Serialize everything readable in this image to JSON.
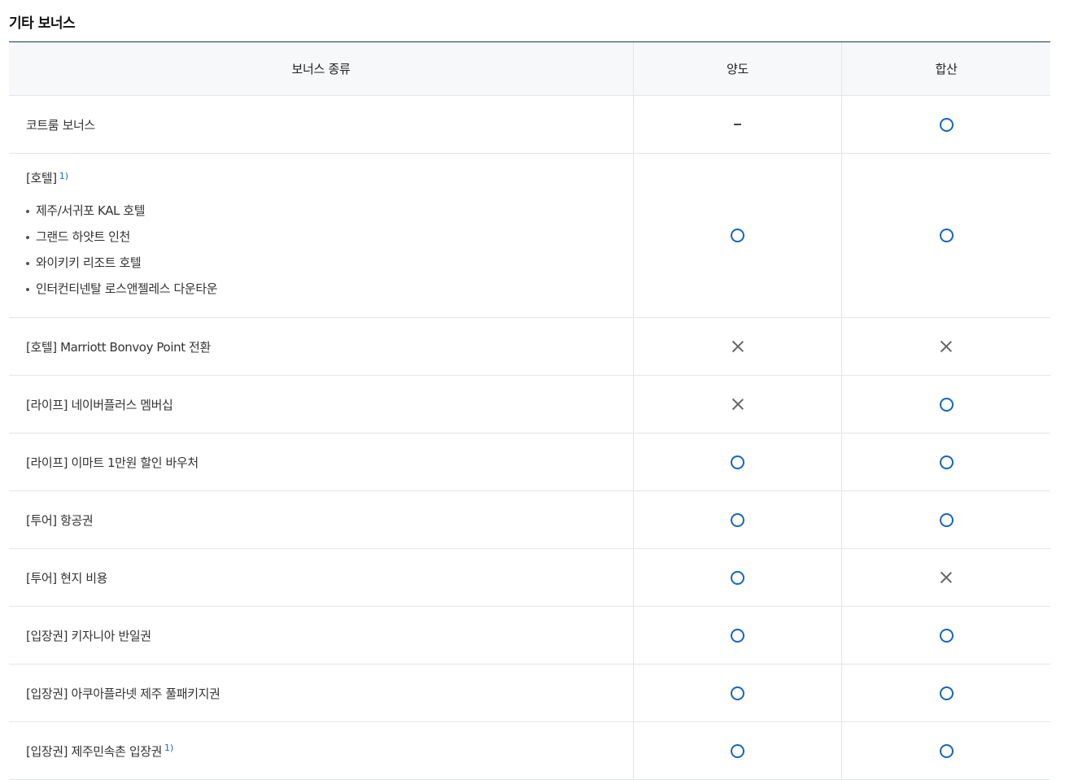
{
  "section_title": "기타 보너스",
  "header": {
    "type": "보너스 종류",
    "transfer": "양도",
    "combine": "합산"
  },
  "rows": [
    {
      "label": "코트룸 보너스",
      "transfer": "dash",
      "combine": "o"
    },
    {
      "label": "[호텔]",
      "sup": "1)",
      "items": [
        "제주/서귀포 KAL 호텔",
        "그랜드 하얏트 인천",
        "와이키키 리조트 호텔",
        "인터컨티넨탈 로스앤젤레스 다운타운"
      ],
      "transfer": "o",
      "combine": "o"
    },
    {
      "label": "[호텔] Marriott Bonvoy Point 전환",
      "transfer": "x",
      "combine": "x"
    },
    {
      "label": "[라이프] 네이버플러스 멤버십",
      "transfer": "x",
      "combine": "o"
    },
    {
      "label": "[라이프] 이마트 1만원 할인 바우처",
      "transfer": "o",
      "combine": "o"
    },
    {
      "label": "[투어] 항공권",
      "transfer": "o",
      "combine": "o"
    },
    {
      "label": "[투어] 현지 비용",
      "transfer": "o",
      "combine": "x"
    },
    {
      "label": "[입장권] 키자니아 반일권",
      "transfer": "o",
      "combine": "o"
    },
    {
      "label": "[입장권] 아쿠아플라넷 제주 풀패키지권",
      "transfer": "o",
      "combine": "o"
    },
    {
      "label": "[입장권] 제주민속촌 입장권",
      "sup": "1)",
      "transfer": "o",
      "combine": "o"
    }
  ],
  "mark_legend": {
    "o": "circle-icon",
    "x": "cross-icon",
    "dash": "dash-icon"
  },
  "colors": {
    "circle": "#1565c0",
    "table_top_border": "#1e3a48",
    "header_bg": "#f7f8fa"
  }
}
